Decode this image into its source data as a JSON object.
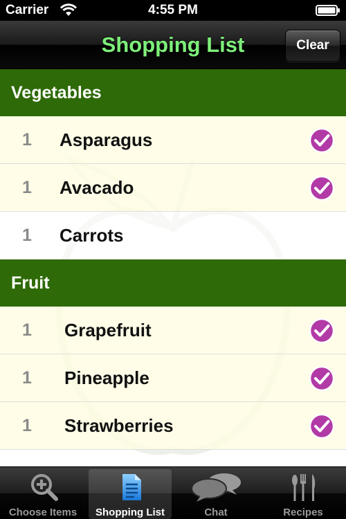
{
  "status_bar": {
    "carrier": "Carrier",
    "time": "4:55 PM"
  },
  "nav": {
    "title": "Shopping List",
    "clear_label": "Clear",
    "title_color": "#7ef07a"
  },
  "sections": [
    {
      "title": "Vegetables",
      "items": [
        {
          "qty": "1",
          "name": "Asparagus",
          "checked": true
        },
        {
          "qty": "1",
          "name": "Avacado",
          "checked": true
        },
        {
          "qty": "1",
          "name": "Carrots",
          "checked": false
        }
      ]
    },
    {
      "title": "Fruit",
      "items": [
        {
          "qty": "1",
          "name": "Grapefruit",
          "checked": true
        },
        {
          "qty": "1",
          "name": "Pineapple",
          "checked": true
        },
        {
          "qty": "1",
          "name": "Strawberries",
          "checked": true
        }
      ]
    }
  ],
  "tabs": [
    {
      "label": "Choose Items",
      "icon": "magnifier-plus-icon",
      "selected": false
    },
    {
      "label": "Shopping List",
      "icon": "document-icon",
      "selected": true
    },
    {
      "label": "Chat",
      "icon": "speech-bubbles-icon",
      "selected": false
    },
    {
      "label": "Recipes",
      "icon": "cutlery-icon",
      "selected": false
    }
  ],
  "colors": {
    "section_header": "#2e6a07",
    "checked_row": "#fffde0",
    "check_mark": "#b23aa6"
  }
}
